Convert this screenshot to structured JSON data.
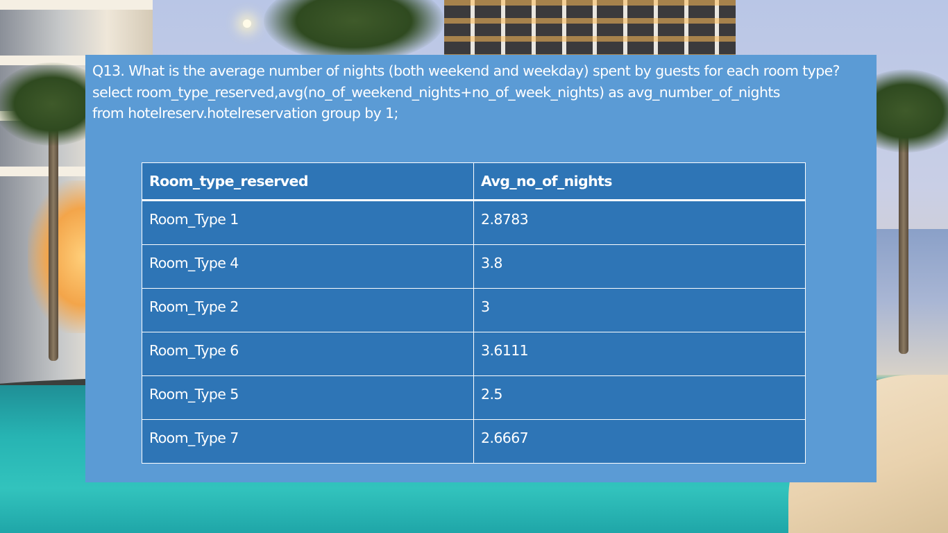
{
  "slide": {
    "question": "Q13. What is the average number of nights (both weekend and weekday) spent by guests for each room type?",
    "query_line_1": "select room_type_reserved,avg(no_of_weekend_nights+no_of_week_nights) as avg_number_of_nights",
    "query_line_2": "from hotelreserv.hotelreservation group by 1;"
  },
  "table": {
    "columns": [
      "Room_type_reserved",
      "Avg_no_of_nights"
    ],
    "rows": [
      [
        "Room_Type 1",
        "2.8783"
      ],
      [
        "Room_Type 4",
        "3.8"
      ],
      [
        "Room_Type 2",
        "3"
      ],
      [
        "Room_Type 6",
        "3.6111"
      ],
      [
        "Room_Type 5",
        "2.5"
      ],
      [
        "Room_Type 7",
        "2.6667"
      ]
    ]
  },
  "colors": {
    "panel": "#5b9bd5",
    "table_cell": "#2e75b6",
    "text": "#ffffff"
  }
}
